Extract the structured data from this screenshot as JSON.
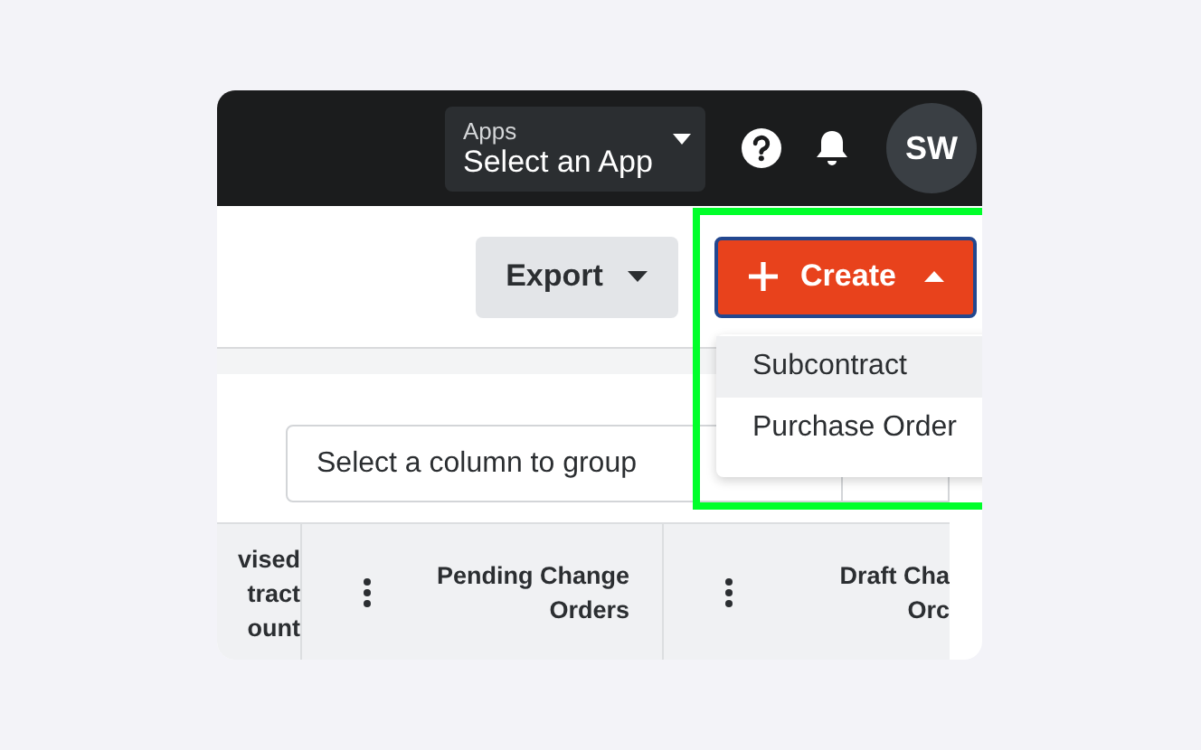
{
  "header": {
    "apps_label": "Apps",
    "app_select": "Select an App",
    "avatar": "SW"
  },
  "toolbar": {
    "export": "Export",
    "create": {
      "label": "Create",
      "expanded": true,
      "highlighted": true
    },
    "menu": [
      {
        "label": "Subcontract",
        "selected": true
      },
      {
        "label": "Purchase Order",
        "selected": false
      }
    ]
  },
  "group_field": {
    "placeholder": "Select a column to group"
  },
  "table": {
    "columns": [
      {
        "lines": [
          "vised",
          "tract",
          "ount"
        ],
        "menu": false
      },
      {
        "lines": [
          "Pending Change",
          "Orders"
        ],
        "menu": true
      },
      {
        "lines": [
          "Draft Cha",
          "Orc"
        ],
        "menu": true
      }
    ]
  }
}
